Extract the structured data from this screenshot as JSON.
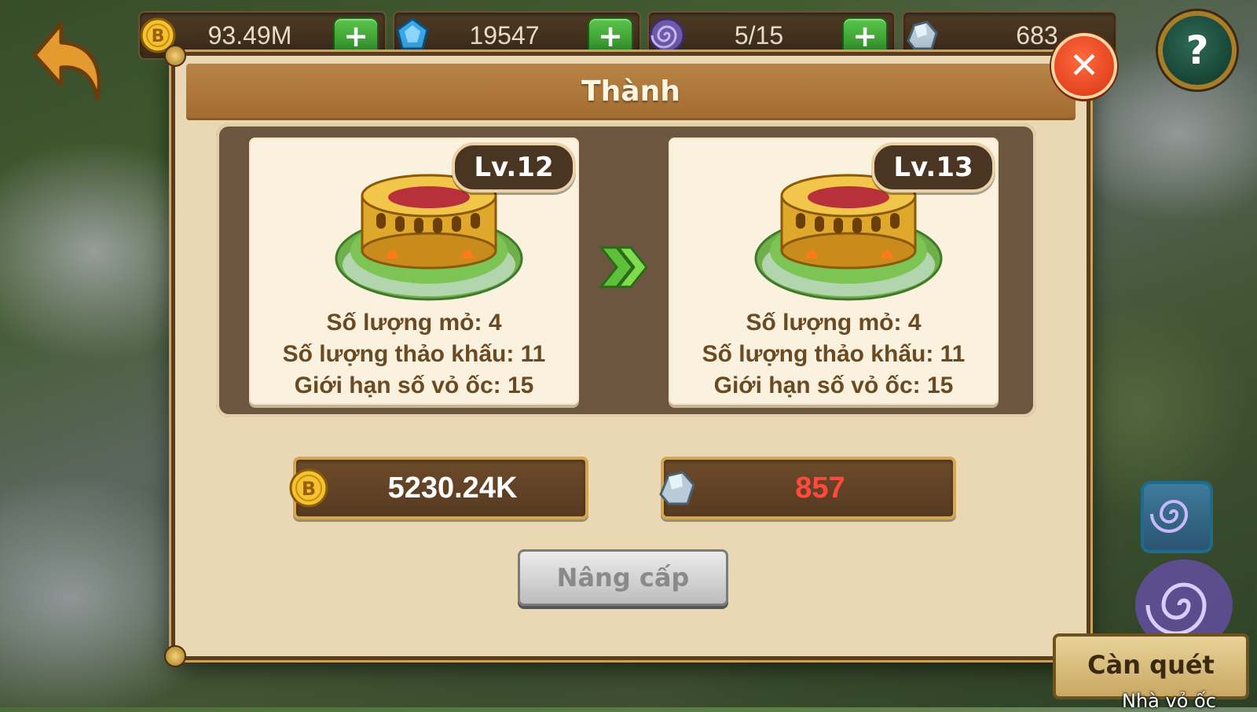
{
  "resources": {
    "gold": "93.49M",
    "gems": "19547",
    "energy": "5/15",
    "stone": "683",
    "plus": "+"
  },
  "dialog": {
    "title": "Thành",
    "close_label": "✕",
    "current": {
      "level": "Lv.12",
      "stats": [
        "Số lượng mỏ: 4",
        "Số lượng thảo khấu: 11",
        "Giới hạn số vỏ ốc: 15"
      ]
    },
    "next": {
      "level": "Lv.13",
      "stats": [
        "Số lượng mỏ: 4",
        "Số lượng thảo khấu: 11",
        "Giới hạn số vỏ ốc: 15"
      ]
    },
    "cost_gold": "5230.24K",
    "cost_stone": "857",
    "upgrade_label": "Nâng cấp"
  },
  "help_label": "?",
  "sweep_label": "Càn quét",
  "map_label": "Nhà vỏ ốc",
  "colors": {
    "cost_gold_text": "#ffffff",
    "cost_stone_text": "#ff4a3d",
    "panel": "#6d5640",
    "card": "#fbf1df"
  },
  "icons": {
    "back": "back-arrow-icon",
    "gold": "gold-coin-icon",
    "gem": "blue-gem-icon",
    "energy": "purple-spiral-icon",
    "stone": "stone-ore-icon",
    "help": "question-icon",
    "close": "close-icon",
    "arrow": "double-chevron-right-icon"
  }
}
